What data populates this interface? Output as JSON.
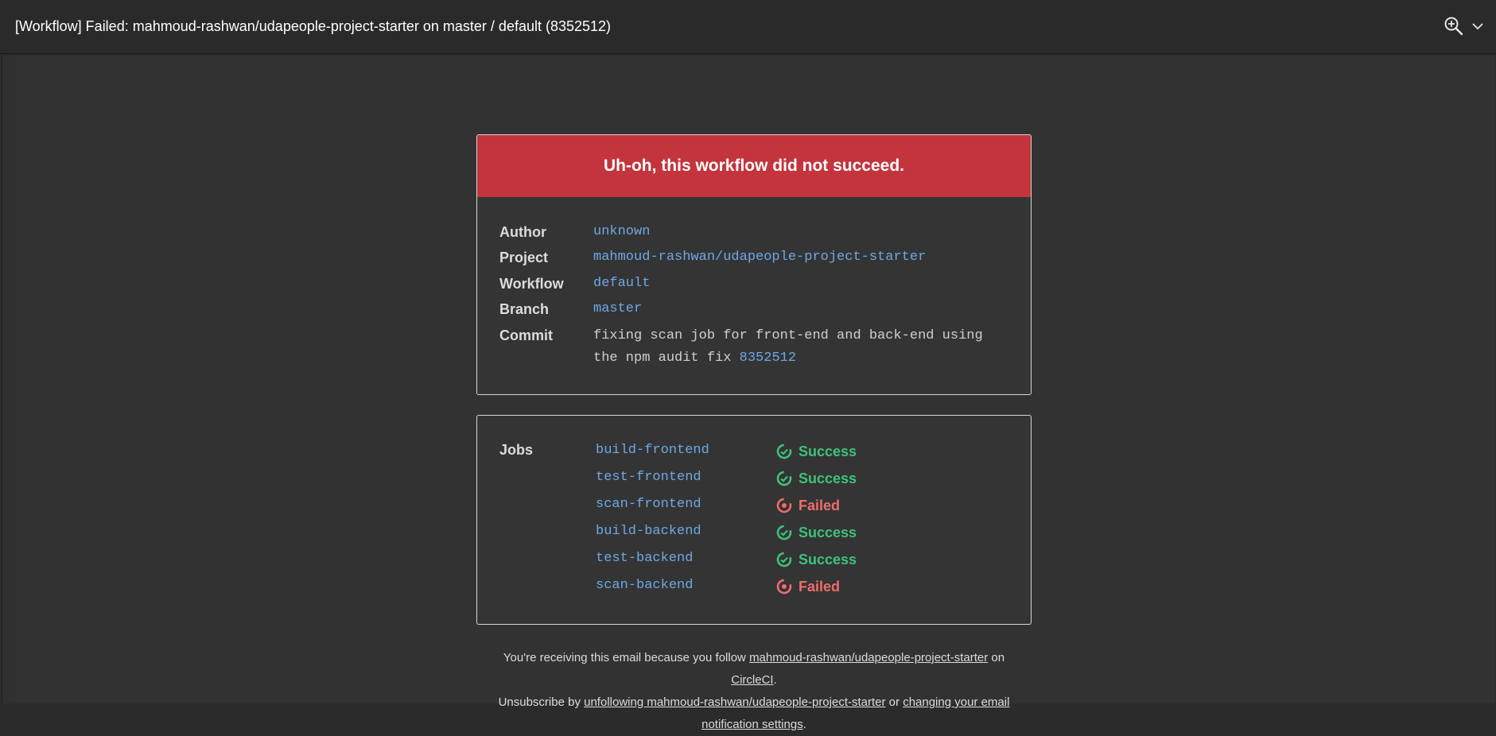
{
  "window": {
    "title": "[Workflow] Failed: mahmoud-rashwan/udapeople-project-starter on master / default (8352512)"
  },
  "banner": {
    "text": "Uh-oh, this workflow did not succeed."
  },
  "details": {
    "author_label": "Author",
    "author": "unknown",
    "project_label": "Project",
    "project": "mahmoud-rashwan/udapeople-project-starter",
    "workflow_label": "Workflow",
    "workflow": "default",
    "branch_label": "Branch",
    "branch": "master",
    "commit_label": "Commit",
    "commit_message": "fixing scan job for front-end and back-end using the npm audit fix",
    "commit_hash": "8352512"
  },
  "jobs": {
    "label": "Jobs",
    "items": [
      {
        "name": "build-frontend",
        "status": "Success"
      },
      {
        "name": "test-frontend",
        "status": "Success"
      },
      {
        "name": "scan-frontend",
        "status": "Failed"
      },
      {
        "name": "build-backend",
        "status": "Success"
      },
      {
        "name": "test-backend",
        "status": "Success"
      },
      {
        "name": "scan-backend",
        "status": "Failed"
      }
    ]
  },
  "footer": {
    "line1_prefix": "You're receiving this email because you follow",
    "line1_link": "mahmoud-rashwan/udapeople-project-starter",
    "line1_on": "on",
    "line1_link2": "CircleCI",
    "line2_prefix": "Unsubscribe by",
    "line2_link": "unfollowing mahmoud-rashwan/udapeople-project-starter",
    "line2_or": "or",
    "line2_link2": "changing your email notification settings"
  },
  "colors": {
    "banner": "#c3343d",
    "success": "#3fc17a",
    "failed": "#f06c6c",
    "link": "#6ea8e6"
  }
}
